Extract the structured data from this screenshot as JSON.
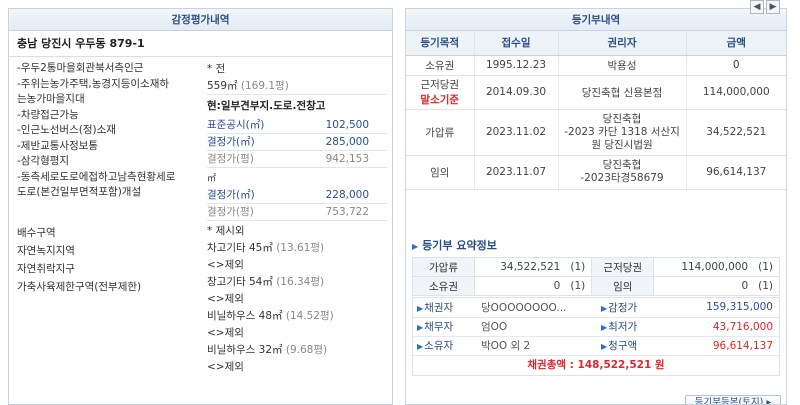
{
  "appraisal": {
    "header": "감정평가내역",
    "address": "충남 당진시 우두동 879-1",
    "conditions": [
      "-우두2통마을회관북서측인근",
      "-주위는농가주택,농경지등이소재하",
      "는농가마을지대",
      "-차량접근가능",
      "-인근노선버스(정)소재",
      "-제반교통사정보통",
      "-삼각형평지",
      "-동측세로도로에접하고남측현황세로",
      "도로(본건일부면적포함)개설"
    ],
    "zoning": [
      "배수구역",
      "자연녹지지역",
      "자연취락지구",
      "가축사육제한구역(전부제한)"
    ],
    "land": {
      "category": "* 전",
      "area": "559㎡",
      "area_pyeong": "(169.1평)",
      "usage": "현:일부견부지.도로.전창고",
      "official_label": "표준공시(㎡)",
      "official_value": "102,500",
      "decided_m2_label": "결정가(㎡)",
      "decided_m2_value": "285,000",
      "decided_py_label": "결정가(평)",
      "decided_py_value": "942,153",
      "unit": "㎡",
      "decided2_m2_label": "결정가(㎡)",
      "decided2_m2_value": "228,000",
      "decided2_py_label": "결정가(평)",
      "decided2_py_value": "753,722"
    },
    "excluded": {
      "title": "* 제시외",
      "items": [
        {
          "name": "차고기타 45㎡",
          "pyeong": "(13.61평)",
          "note": "<>제외"
        },
        {
          "name": "창고기타 54㎡",
          "pyeong": "(16.34평)",
          "note": "<>제외"
        },
        {
          "name": "비닐하우스 48㎡",
          "pyeong": "(14.52평)",
          "note": "<>제외"
        },
        {
          "name": "비닐하우스 32㎡",
          "pyeong": "(9.68평)",
          "note": "<>제외"
        }
      ]
    }
  },
  "registry": {
    "header": "등기부내역",
    "columns": [
      "등기목적",
      "접수일",
      "권리자",
      "금액"
    ],
    "rows": [
      {
        "purpose": "소유권",
        "purpose2": "",
        "date": "1995.12.23",
        "holder": "박용성",
        "holder2": "",
        "amount": "0"
      },
      {
        "purpose": "근저당권",
        "purpose2": "말소기준",
        "date": "2014.09.30",
        "holder": "당진축협 신용본점",
        "holder2": "",
        "amount": "114,000,000"
      },
      {
        "purpose": "가압류",
        "purpose2": "",
        "date": "2023.11.02",
        "holder": "당진축협",
        "holder2": "-2023 카단 1318 서산지 원 당진시법원",
        "amount": "34,522,521"
      },
      {
        "purpose": "임의",
        "purpose2": "",
        "date": "2023.11.07",
        "holder": "당진축협",
        "holder2": "-2023타경58679",
        "amount": "96,614,137"
      }
    ],
    "summary_title": "등기부 요약정보",
    "summary": [
      {
        "label1": "가압류",
        "val1": "34,522,521",
        "cnt1": "(1)",
        "label2": "근저당권",
        "val2": "114,000,000",
        "cnt2": "(1)"
      },
      {
        "label1": "소유권",
        "val1": "0",
        "cnt1": "(1)",
        "label2": "임의",
        "val2": "0",
        "cnt2": "(1)"
      }
    ],
    "parties": [
      {
        "label1": "채권자",
        "val1": "당OOOOOOOO...",
        "label2": "감정가",
        "val2": "159,315,000"
      },
      {
        "label1": "채무자",
        "val1": "엄OO",
        "label2": "최저가",
        "val2": "43,716,000"
      },
      {
        "label1": "소유자",
        "val1": "박OO 외 2",
        "label2": "청구액",
        "val2": "96,614,137"
      }
    ],
    "total": "채권총액 : 148,522,521 원",
    "button": "등기부등본(토지)",
    "colors": {
      "accent": "#2a4f86",
      "red": "#e0262a"
    }
  }
}
